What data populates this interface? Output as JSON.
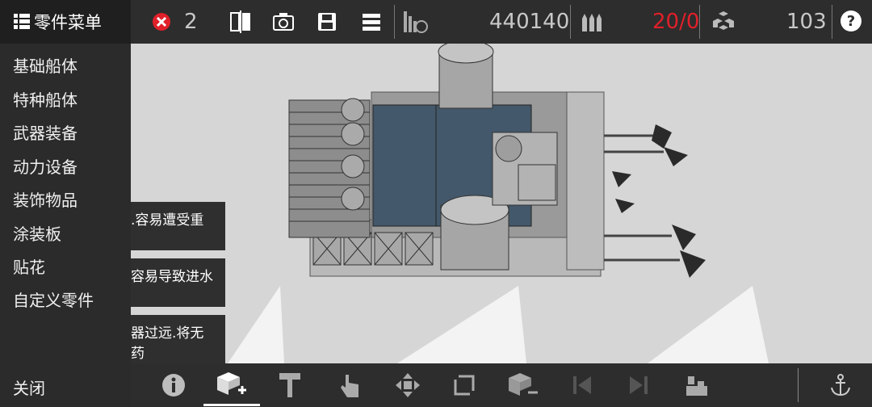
{
  "menu": {
    "title": "零件菜单"
  },
  "stats": {
    "errors": "2",
    "cost": "440140",
    "weapons": "20/0",
    "parts": "103"
  },
  "sidebar": {
    "items": [
      {
        "label": "基础船体"
      },
      {
        "label": "特种船体"
      },
      {
        "label": "武器装备"
      },
      {
        "label": "动力设备"
      },
      {
        "label": "装饰物品"
      },
      {
        "label": "涂装板"
      },
      {
        "label": "贴花"
      },
      {
        "label": "自定义零件"
      }
    ],
    "close_label": "关闭"
  },
  "tips": [
    {
      "lines": [
        ".容易遭受重"
      ]
    },
    {
      "lines": [
        "容易导致进水"
      ]
    },
    {
      "lines": [
        "器过远.将无",
        "药"
      ]
    }
  ],
  "colors": {
    "accent": "#e0202a",
    "bar": "#2d2d2d",
    "deck": "#43586a"
  },
  "icons": {
    "top": [
      "grid-icon",
      "error-icon",
      "mirror-icon",
      "camera-icon",
      "save-icon",
      "list-icon",
      "weight-icon",
      "ammo-icon",
      "parts-icon",
      "help-icon"
    ],
    "bottom": [
      "info-icon",
      "add-part-icon",
      "paint-roller-icon",
      "touch-icon",
      "move-icon",
      "rotate-icon",
      "remove-part-icon",
      "prev-icon",
      "next-icon",
      "layer-icon",
      "anchor-icon"
    ]
  }
}
